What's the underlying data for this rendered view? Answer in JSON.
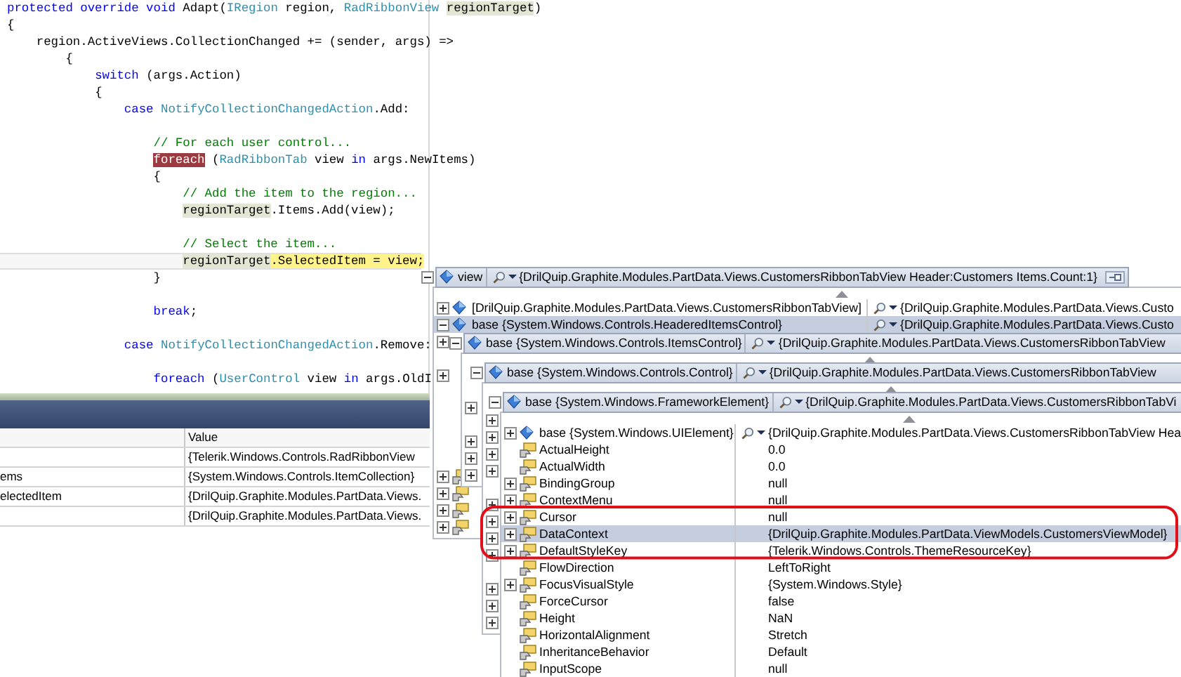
{
  "editor": {
    "lines": [
      {
        "kind": "code",
        "current": false,
        "tokens": [
          {
            "kind": "keyword",
            "text": "protected override void"
          },
          {
            "kind": "plain",
            "text": " Adapt("
          },
          {
            "kind": "type",
            "text": "IRegion"
          },
          {
            "kind": "plain",
            "text": " region, "
          },
          {
            "kind": "type",
            "text": "RadRibbonView "
          },
          {
            "kind": "reference",
            "text": "regionTarget"
          },
          {
            "kind": "plain",
            "text": ")"
          }
        ]
      },
      {
        "kind": "code",
        "current": false,
        "tokens": [
          {
            "kind": "plain",
            "text": "{"
          }
        ]
      },
      {
        "kind": "code",
        "current": false,
        "tokens": [
          {
            "kind": "plain",
            "text": "    region.ActiveViews.CollectionChanged += (sender, args) =>"
          }
        ]
      },
      {
        "kind": "code",
        "current": false,
        "tokens": [
          {
            "kind": "plain",
            "text": "        {"
          }
        ]
      },
      {
        "kind": "code",
        "current": false,
        "tokens": [
          {
            "kind": "keyword",
            "text": "            switch"
          },
          {
            "kind": "plain",
            "text": " (args.Action)"
          }
        ]
      },
      {
        "kind": "code",
        "current": false,
        "tokens": [
          {
            "kind": "plain",
            "text": "            {"
          }
        ]
      },
      {
        "kind": "code",
        "current": false,
        "tokens": [
          {
            "kind": "keyword",
            "text": "                case "
          },
          {
            "kind": "type",
            "text": "NotifyCollectionChangedAction"
          },
          {
            "kind": "plain",
            "text": ".Add:"
          }
        ]
      },
      {
        "kind": "blank",
        "current": false
      },
      {
        "kind": "code",
        "current": false,
        "tokens": [
          {
            "kind": "comment",
            "text": "                    // For each user control..."
          }
        ]
      },
      {
        "kind": "code",
        "current": false,
        "tokens": [
          {
            "kind": "breakpoint",
            "text": "                    foreach"
          },
          {
            "kind": "plain",
            "text": " ("
          },
          {
            "kind": "type",
            "text": "RadRibbonTab"
          },
          {
            "kind": "plain",
            "text": " view "
          },
          {
            "kind": "keyword",
            "text": "in"
          },
          {
            "kind": "plain",
            "text": " args.NewItems)"
          }
        ]
      },
      {
        "kind": "code",
        "current": false,
        "tokens": [
          {
            "kind": "plain",
            "text": "                    {"
          }
        ]
      },
      {
        "kind": "code",
        "current": false,
        "tokens": [
          {
            "kind": "comment",
            "text": "                        // Add the item to the region..."
          }
        ]
      },
      {
        "kind": "code",
        "current": false,
        "tokens": [
          {
            "kind": "reference",
            "text": "                        regionTarget"
          },
          {
            "kind": "plain",
            "text": ".Items.Add(view);"
          }
        ]
      },
      {
        "kind": "blank",
        "current": false
      },
      {
        "kind": "code",
        "current": false,
        "tokens": [
          {
            "kind": "comment",
            "text": "                        // Select the item..."
          }
        ]
      },
      {
        "kind": "code",
        "current": true,
        "tokens": [
          {
            "kind": "reference",
            "text": "                        regionTarget"
          },
          {
            "kind": "current",
            "text": ".SelectedItem = view;"
          }
        ]
      },
      {
        "kind": "code",
        "current": false,
        "tokens": [
          {
            "kind": "plain",
            "text": "                    }"
          }
        ]
      },
      {
        "kind": "blank",
        "current": false
      },
      {
        "kind": "code",
        "current": false,
        "tokens": [
          {
            "kind": "keyword",
            "text": "                    break"
          },
          {
            "kind": "plain",
            "text": ";"
          }
        ]
      },
      {
        "kind": "blank",
        "current": false
      },
      {
        "kind": "code",
        "current": false,
        "tokens": [
          {
            "kind": "keyword",
            "text": "                case "
          },
          {
            "kind": "type",
            "text": "NotifyCollectionChangedAction"
          },
          {
            "kind": "plain",
            "text": ".Remove:"
          }
        ]
      },
      {
        "kind": "blank",
        "current": false
      },
      {
        "kind": "code",
        "current": false,
        "tokens": [
          {
            "kind": "keyword",
            "text": "                    foreach"
          },
          {
            "kind": "plain",
            "text": " ("
          },
          {
            "kind": "type",
            "text": "UserControl"
          },
          {
            "kind": "plain",
            "text": " view "
          },
          {
            "kind": "keyword",
            "text": "in"
          },
          {
            "kind": "plain",
            "text": " args.OldI"
          }
        ]
      }
    ]
  },
  "watch": {
    "value_header": "Value",
    "rows": [
      {
        "value": "{Telerik.Windows.Controls.RadRibbonView"
      },
      {
        "name": "ems",
        "value": "{System.Windows.Controls.ItemCollection}"
      },
      {
        "name": "electedItem",
        "value": "{DrilQuip.Graphite.Modules.PartData.Views."
      },
      {
        "value": "{DrilQuip.Graphite.Modules.PartData.Views."
      }
    ]
  },
  "datatips": [
    {
      "header": {
        "label": "view",
        "value": "{DrilQuip.Graphite.Modules.PartData.Views.CustomersRibbonTabView Header:Customers Items.Count:1}",
        "expanded": true,
        "pin_button": true
      },
      "rows": [
        {
          "kind": "object",
          "expandable": true,
          "expanded": false,
          "selected": false,
          "visualizer": true,
          "label": "[DrilQuip.Graphite.Modules.PartData.Views.CustomersRibbonTabView]",
          "value": "{DrilQuip.Graphite.Modules.PartData.Views.Custo"
        },
        {
          "kind": "object",
          "expandable": true,
          "expanded": true,
          "selected": true,
          "visualizer": true,
          "label": "base {System.Windows.Controls.HeaderedItemsControl}",
          "value": "{DrilQuip.Graphite.Modules.PartData.Views.Custo"
        },
        {
          "expandable": true,
          "expanded": false,
          "selected": false
        },
        {
          "expandable": false,
          "selected": false
        },
        {
          "expandable": true,
          "expanded": false,
          "selected": false
        },
        {
          "expandable": false,
          "selected": false
        },
        {
          "expandable": false,
          "selected": false
        },
        {
          "expandable": false,
          "selected": false
        },
        {
          "expandable": false,
          "selected": false
        },
        {
          "expandable": false,
          "selected": false
        },
        {
          "kind": "property",
          "expandable": true,
          "expanded": false,
          "selected": false
        },
        {
          "kind": "property",
          "expandable": true,
          "expanded": false,
          "selected": false
        },
        {
          "kind": "property",
          "expandable": true,
          "expanded": false,
          "selected": false
        },
        {
          "kind": "property",
          "expandable": true,
          "expanded": false,
          "selected": false
        }
      ]
    },
    {
      "header": {
        "label": "base {System.Windows.Controls.ItemsControl}",
        "value": "{DrilQuip.Graphite.Modules.PartData.Views.CustomersRibbonTabView",
        "expanded": true
      },
      "rows": [
        {
          "expandable": false,
          "selected": false
        },
        {
          "expandable": false,
          "selected": false
        },
        {
          "expandable": true,
          "expanded": false,
          "selected": false
        },
        {
          "expandable": false,
          "selected": false
        },
        {
          "expandable": true,
          "expanded": false,
          "selected": false
        },
        {
          "expandable": true,
          "expanded": false,
          "selected": false
        },
        {
          "expandable": true,
          "expanded": false,
          "selected": false
        }
      ]
    },
    {
      "header": {
        "label": "base {System.Windows.Controls.Control}",
        "value": "{DrilQuip.Graphite.Modules.PartData.Views.CustomersRibbonTabView",
        "expanded": true
      },
      "rows": [
        {
          "expandable": false,
          "selected": false
        },
        {
          "expandable": true,
          "expanded": false,
          "selected": false
        },
        {
          "expandable": true,
          "expanded": false,
          "selected": false
        },
        {
          "expandable": true,
          "expanded": false,
          "selected": false
        },
        {
          "expandable": true,
          "expanded": false,
          "selected": false
        },
        {
          "expandable": false,
          "selected": false
        },
        {
          "expandable": true,
          "expanded": false,
          "selected": false
        },
        {
          "expandable": true,
          "expanded": false,
          "selected": false
        },
        {
          "expandable": true,
          "expanded": false,
          "selected": false
        },
        {
          "expandable": true,
          "expanded": false,
          "selected": false
        },
        {
          "expandable": false,
          "selected": false
        },
        {
          "expandable": true,
          "expanded": false,
          "selected": false
        },
        {
          "expandable": true,
          "expanded": false,
          "selected": false
        },
        {
          "expandable": true,
          "expanded": false,
          "selected": false
        }
      ]
    },
    {
      "header": {
        "label": "base {System.Windows.FrameworkElement}",
        "value": "{DrilQuip.Graphite.Modules.PartData.Views.CustomersRibbonTabVi",
        "expanded": true
      },
      "rows": [
        {
          "kind": "object",
          "expandable": true,
          "expanded": false,
          "selected": false,
          "visualizer": true,
          "label": "base {System.Windows.UIElement}",
          "value": "{DrilQuip.Graphite.Modules.PartData.Views.CustomersRibbonTabView Hea"
        },
        {
          "kind": "property",
          "expandable": false,
          "selected": false,
          "label": "ActualHeight",
          "value": "0.0"
        },
        {
          "kind": "property",
          "expandable": false,
          "selected": false,
          "label": "ActualWidth",
          "value": "0.0"
        },
        {
          "kind": "property",
          "expandable": true,
          "expanded": false,
          "selected": false,
          "label": "BindingGroup",
          "value": "null"
        },
        {
          "kind": "property",
          "expandable": true,
          "expanded": false,
          "selected": false,
          "label": "ContextMenu",
          "value": "null"
        },
        {
          "kind": "property",
          "expandable": true,
          "expanded": false,
          "selected": false,
          "label": "Cursor",
          "value": "null"
        },
        {
          "kind": "property",
          "expandable": true,
          "expanded": false,
          "selected": true,
          "label": "DataContext",
          "value": "{DrilQuip.Graphite.Modules.PartData.ViewModels.CustomersViewModel}"
        },
        {
          "kind": "property",
          "expandable": true,
          "expanded": false,
          "selected": false,
          "label": "DefaultStyleKey",
          "value": "{Telerik.Windows.Controls.ThemeResourceKey}"
        },
        {
          "kind": "property",
          "expandable": false,
          "selected": false,
          "label": "FlowDirection",
          "value": "LeftToRight"
        },
        {
          "kind": "property",
          "expandable": true,
          "expanded": false,
          "selected": false,
          "label": "FocusVisualStyle",
          "value": "{System.Windows.Style}"
        },
        {
          "kind": "property",
          "expandable": false,
          "selected": false,
          "label": "ForceCursor",
          "value": "false"
        },
        {
          "kind": "property",
          "expandable": false,
          "selected": false,
          "label": "Height",
          "value": "NaN"
        },
        {
          "kind": "property",
          "expandable": false,
          "selected": false,
          "label": "HorizontalAlignment",
          "value": "Stretch"
        },
        {
          "kind": "property",
          "expandable": false,
          "selected": false,
          "label": "InheritanceBehavior",
          "value": "Default"
        },
        {
          "kind": "property",
          "expandable": false,
          "selected": false,
          "label": "InputScope",
          "value": "null"
        }
      ]
    }
  ]
}
